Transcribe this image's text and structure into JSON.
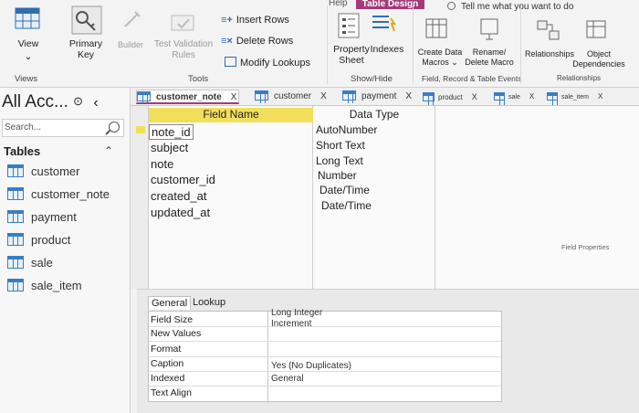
{
  "ribbon": {
    "help_tab": "Help",
    "context_tab": "Table Design",
    "tell_me": "Tell me what you want to do",
    "buttons": {
      "view": "View",
      "primary_key_line1": "Primary",
      "primary_key_line2": "Key",
      "builder": "Builder",
      "test_validation_line1": "Test Validation",
      "test_validation_line2": "Rules",
      "insert_rows": "Insert Rows",
      "delete_rows": "Delete Rows",
      "modify_lookups": "Modify Lookups",
      "property_sheet_line1": "Property",
      "property_sheet_line2": "Sheet",
      "indexes": "Indexes",
      "create_data_macros_line1": "Create Data",
      "create_data_macros_line2": "Macros",
      "rename_delete_macro_line1": "Rename/",
      "rename_delete_macro_line2": "Delete Macro",
      "relationships": "Relationships",
      "object_dependencies_line1": "Object",
      "object_dependencies_line2": "Dependencies"
    },
    "groups": {
      "views": "Views",
      "tools": "Tools",
      "show_hide": "Show/Hide",
      "field_record_events": "Field, Record & Table Events",
      "relationships": "Relationships"
    }
  },
  "nav": {
    "title": "All Acc...",
    "search_placeholder": "Search...",
    "section": "Tables",
    "items": [
      "customer",
      "customer_note",
      "payment",
      "product",
      "sale",
      "sale_item"
    ]
  },
  "doc_tabs": [
    {
      "label": "customer_note",
      "close": "X"
    },
    {
      "label": "customer",
      "close": "X"
    },
    {
      "label": "payment",
      "close": "X"
    },
    {
      "label": "product",
      "close": "X"
    },
    {
      "label": "sale",
      "close": "X"
    },
    {
      "label": "sale_item",
      "close": "X"
    }
  ],
  "design": {
    "field_name_header": "Field Name",
    "data_type_header": "Data Type",
    "rows": [
      {
        "name": "note_id",
        "type": "AutoNumber"
      },
      {
        "name": "subject",
        "type": "Short Text"
      },
      {
        "name": "note",
        "type": "Long Text"
      },
      {
        "name": "customer_id",
        "type": "Number"
      },
      {
        "name": "created_at",
        "type": "Date/Time"
      },
      {
        "name": "updated_at",
        "type": "Date/Time"
      }
    ],
    "field_properties": "Field Properties"
  },
  "props": {
    "tabs": [
      "General",
      "Lookup"
    ],
    "rows": [
      {
        "label": "Field Size",
        "value": "Long Integer"
      },
      {
        "label": "New Values",
        "value": "Increment"
      },
      {
        "label": "Format",
        "value": ""
      },
      {
        "label": "Caption",
        "value": ""
      },
      {
        "label": "Indexed",
        "value": "Yes (No Duplicates)"
      },
      {
        "label": "Text Align",
        "value": "General"
      }
    ]
  },
  "colors": {
    "accent": "#a33b7a",
    "header_yellow": "#f1df5a",
    "table_icon": "#3a7dc4"
  }
}
